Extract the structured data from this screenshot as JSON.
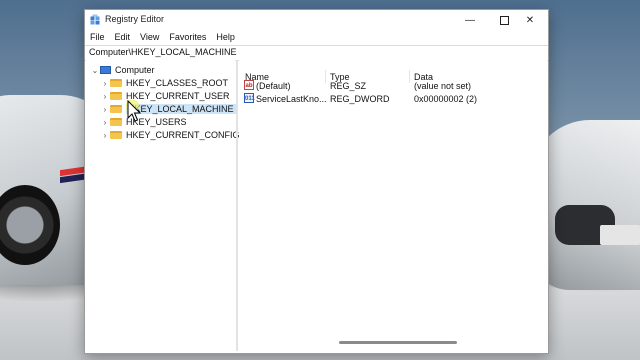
{
  "window": {
    "title": "Registry Editor",
    "controls": {
      "minimize": "—",
      "close": "✕"
    }
  },
  "menu": [
    "File",
    "Edit",
    "View",
    "Favorites",
    "Help"
  ],
  "address": "Computer\\HKEY_LOCAL_MACHINE",
  "tree": {
    "root": "Computer",
    "items": [
      {
        "label": "HKEY_CLASSES_ROOT",
        "selected": false
      },
      {
        "label": "HKEY_CURRENT_USER",
        "selected": false
      },
      {
        "label": "HKEY_LOCAL_MACHINE",
        "selected": true
      },
      {
        "label": "HKEY_USERS",
        "selected": false
      },
      {
        "label": "HKEY_CURRENT_CONFIG",
        "selected": false
      }
    ]
  },
  "list": {
    "columns": [
      "Name",
      "Type",
      "Data"
    ],
    "rows": [
      {
        "icon": "string-value-icon",
        "icon_text": "ab",
        "name": "(Default)",
        "type": "REG_SZ",
        "data": "(value not set)"
      },
      {
        "icon": "binary-value-icon",
        "icon_text": "011",
        "name": "ServiceLastKno...",
        "type": "REG_DWORD",
        "data": "0x00000002 (2)"
      }
    ]
  },
  "colors": {
    "selection": "#cce4f7",
    "folder": "#f3c44e"
  }
}
